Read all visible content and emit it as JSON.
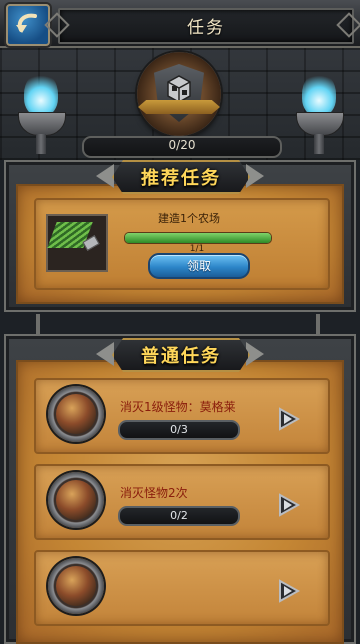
{
  "header": {
    "title": "任务",
    "back_icon": "back-arrow-icon"
  },
  "hall": {
    "progress": "0/20",
    "emblem_icon": "quest-shield-emblem-icon"
  },
  "recommended": {
    "section_title": "推荐任务",
    "task": {
      "name": "建造1个农场",
      "progress_text": "1/1",
      "progress_fraction": 1.0,
      "button_label": "领取",
      "icon": "farm-build-icon"
    }
  },
  "normal": {
    "section_title": "普通任务",
    "tasks": [
      {
        "name": "消灭1级怪物：莫格莱",
        "progress": "0/3",
        "avatar_icon": "monster-portrait-icon",
        "go_icon": "go-arrow-icon"
      },
      {
        "name": "消灭怪物2次",
        "progress": "0/2",
        "avatar_icon": "monster-portrait-icon",
        "go_icon": "go-arrow-icon"
      },
      {
        "name": "",
        "progress": "",
        "avatar_icon": "monster-portrait-icon",
        "go_icon": "go-arrow-icon"
      }
    ]
  },
  "colors": {
    "title_gold": "#ffd75a",
    "task_red": "#8a1d0c",
    "claim_blue": "#2d86c9",
    "torch_blue": "#62d4f4"
  }
}
